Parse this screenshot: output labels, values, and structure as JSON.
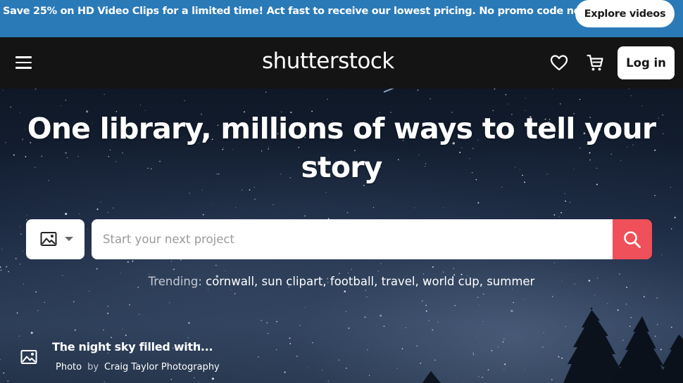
{
  "promo_banner": {
    "text": "Save 25% on HD Video Clips for a limited time! Act fast to receive our lowest pricing. No promo code needed.",
    "cta_label": "Explore videos",
    "background_color": "#2a7ab8"
  },
  "header": {
    "logo_text": "shutterstock",
    "menu_icon": "hamburger-menu-icon",
    "favorites_icon": "heart-icon",
    "cart_icon": "cart-icon",
    "login_label": "Log in",
    "background_color": "#141414"
  },
  "hero": {
    "headline": "One library, millions of ways to tell your story",
    "search": {
      "type_icon": "image-icon",
      "placeholder": "Start your next project",
      "value": "",
      "button_icon": "search-icon",
      "button_color": "#f0505a"
    },
    "trending": {
      "label": "Trending:",
      "items": [
        "cornwall",
        "sun clipart",
        "football",
        "travel",
        "world cup",
        "summer"
      ]
    },
    "credit": {
      "icon": "image-icon",
      "title": "The night sky filled with...",
      "type": "Photo",
      "by": "by",
      "author": "Craig Taylor Photography"
    }
  }
}
